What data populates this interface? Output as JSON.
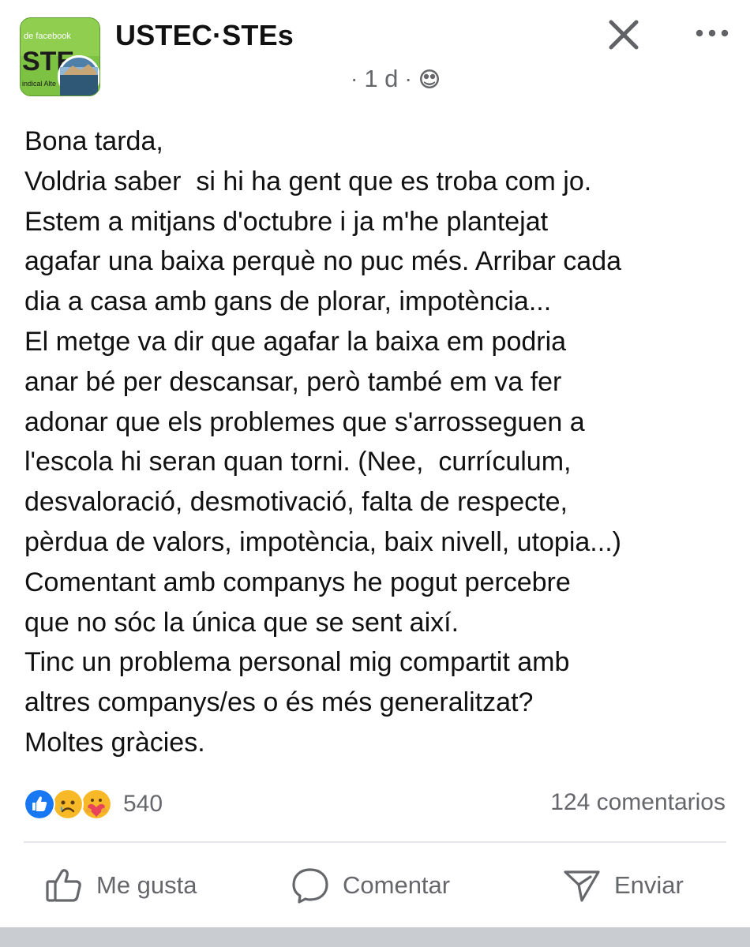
{
  "post": {
    "page_name": "USTEC·STEs",
    "time": "1 d",
    "privacy_icon": "globe-icon",
    "avatar_text_top": "de facebook",
    "avatar_logo_text": "STE",
    "avatar_text_bottom": "indical Alte",
    "body_lines": [
      "Bona tarda,",
      "Voldria saber  si hi ha gent que es troba com jo.",
      "Estem a mitjans d'octubre i ja m'he plantejat",
      "agafar una baixa perquè no puc més. Arribar cada",
      "dia a casa amb gans de plorar, impotència...",
      "El metge va dir que agafar la baixa em podria",
      "anar bé per descansar, però també em va fer",
      "adonar que els problemes que s'arrosseguen a",
      "l'escola hi seran quan torni. (Nee,  currículum,",
      "desvaloració, desmotivació, falta de respecte,",
      "pèrdua de valors, impotència, baix nivell, utopia...)",
      "Comentant amb companys he pogut percebre",
      "que no sóc la única que se sent així.",
      "Tinc un problema personal mig compartit amb",
      "altres companys/es o és més generalitzat?",
      "Moltes gràcies."
    ]
  },
  "reactions": {
    "icons": [
      "like-reaction-icon",
      "sad-reaction-icon",
      "care-reaction-icon"
    ],
    "count": "540"
  },
  "comments": {
    "count_label": "124 comentarios"
  },
  "actions": {
    "like_label": "Me gusta",
    "comment_label": "Comentar",
    "send_label": "Enviar"
  },
  "colors": {
    "text": "#111111",
    "secondary_text": "#65676b",
    "like_blue": "#1877f2",
    "reaction_yellow": "#f7b928",
    "care_red": "#e9455a",
    "avatar_green": "#7dc242",
    "divider": "#e4e6eb",
    "bottom_bar": "#c9ccd1"
  }
}
